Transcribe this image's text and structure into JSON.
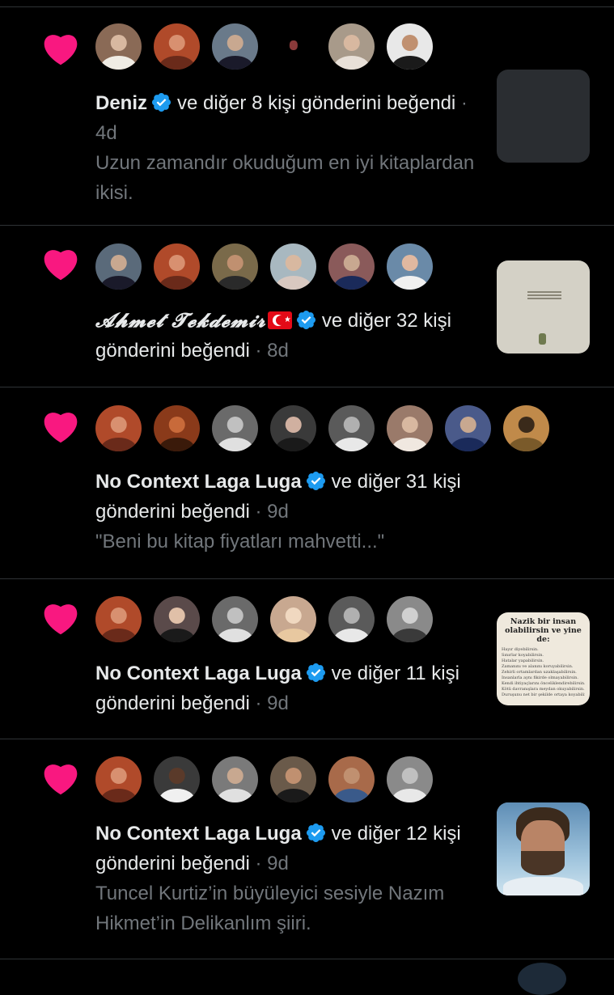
{
  "colors": {
    "background": "#000000",
    "text": "#e7e9ea",
    "muted": "#71767b",
    "heart": "#f91880",
    "verified": "#1d9bf0",
    "divider": "#2f3336"
  },
  "icons": {
    "like": "heart-icon",
    "verified": "verified-badge-icon",
    "flag": "turkey-flag-emoji"
  },
  "notifications": [
    {
      "name": "Deniz",
      "action": "ve diğer 8 kişi gönderini beğendi",
      "time": "4d",
      "preview": "Uzun zamandır okuduğum en iyi kitaplardan ikisi.",
      "avatar_colors": [
        "#8a6a56",
        "#b04a2a",
        "#6a7a8a",
        "#4a2a2a",
        "#a89a8a",
        "#3a3a3a"
      ],
      "thumbnail": "dark"
    },
    {
      "name": "𝓐𝓱𝓶𝓮𝓽 𝓣𝓮𝓴𝓭𝓮𝓶𝓲𝓻",
      "action": "ve diğer 32 kişi gönderini beğendi",
      "time": "8d",
      "preview": "",
      "avatar_colors": [
        "#5a6a7a",
        "#b04a2a",
        "#7a6a4a",
        "#a8b8c0",
        "#8a5a5a",
        "#6a8aa8"
      ],
      "thumbnail": "sketch"
    },
    {
      "name": "No Context Laga Luga",
      "action": "ve diğer 31 kişi gönderini beğendi",
      "time": "9d",
      "preview": "\"Beni bu kitap fiyatları mahvetti...\"",
      "avatar_colors": [
        "#b04a2a",
        "#8a3a1a",
        "#6a6a6a",
        "#3a3a3a",
        "#5a5a5a",
        "#9a7a6a",
        "#4a5a8a",
        "#c08a4a"
      ],
      "thumbnail": "none"
    },
    {
      "name": "No Context Laga Luga",
      "action": "ve diğer 11 kişi gönderini beğendi",
      "time": "9d",
      "preview": "",
      "avatar_colors": [
        "#b04a2a",
        "#5a4a4a",
        "#6a6a6a",
        "#c8a890",
        "#5a5a5a",
        "#8a8a8a"
      ],
      "thumbnail": "text",
      "thumbnail_text": {
        "heading": "Nazik bir insan olabilirsin ve yine de:",
        "lines": [
          "Hayır diyebilirsin.",
          "Sınırlar koyabilirsin.",
          "Hatalar yapabilirsin.",
          "Zamanını ve alanını koruyabilirsin.",
          "Zehirli ortamlardan uzaklaşabilirsin.",
          "İnsanlarla aynı fikirde olmayabilirsin.",
          "Kendi ihtiyaçlarını önceliklendirebilirsin.",
          "Kötü davranışlara meydan okuyabilirsin.",
          "Duruşunu net bir şekilde ortaya koyabilirsin."
        ]
      }
    },
    {
      "name": "No Context Laga Luga",
      "action": "ve diğer 12 kişi gönderini beğendi",
      "time": "9d",
      "preview": "Tuncel Kurtiz’in büyüleyici sesiyle Nazım Hikmet’in Delikanlım şiiri.",
      "avatar_colors": [
        "#b04a2a",
        "#3a3a3a",
        "#7a7a7a",
        "#6a5a4a",
        "#a86a4a",
        "#8a8a8a"
      ],
      "thumbnail": "photo"
    }
  ]
}
